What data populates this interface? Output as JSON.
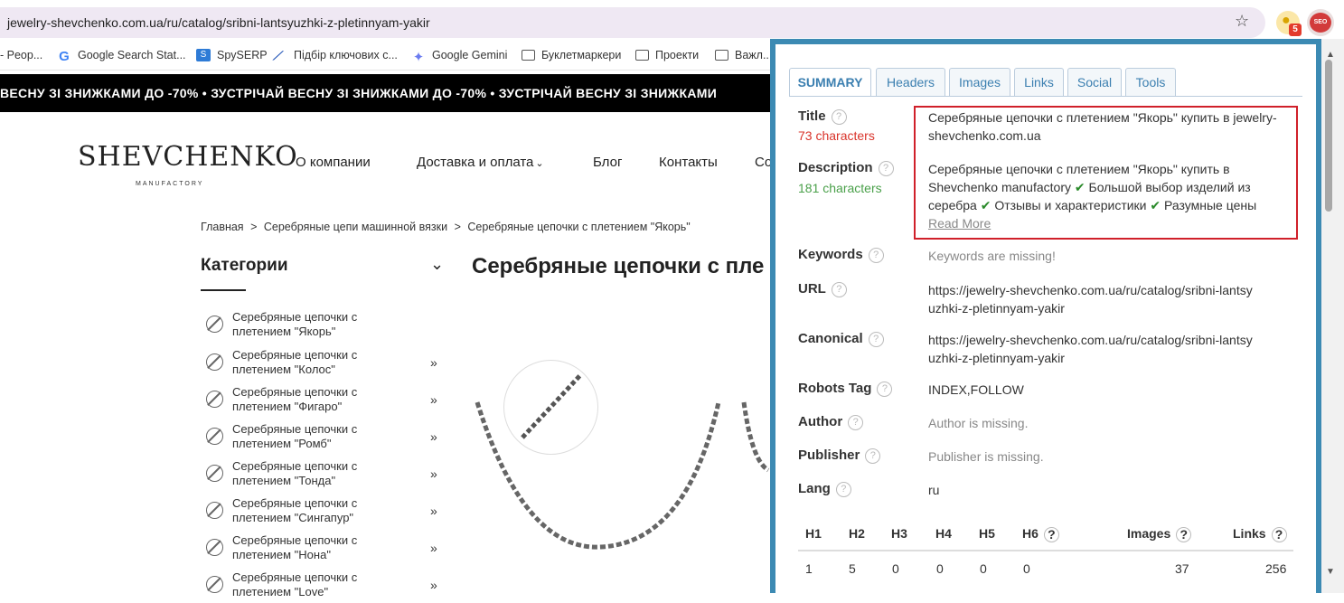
{
  "browser": {
    "url": "jewelry-shevchenko.com.ua/ru/catalog/sribni-lantsyuzhki-z-pletinnyam-yakir",
    "extension_badge": "5",
    "seo_ext_label": "SEO",
    "bookmarks": [
      {
        "label": "- Peop...",
        "icon": "none"
      },
      {
        "label": "Google Search Stat...",
        "icon": "google-icon"
      },
      {
        "label": "SpySERP",
        "icon": "spyserp-icon"
      },
      {
        "label": "Підбір ключових с...",
        "icon": "keyword-icon"
      },
      {
        "label": "Google Gemini",
        "icon": "gemini-icon"
      },
      {
        "label": "Буклетмаркери",
        "icon": "folder-icon"
      },
      {
        "label": "Проекти",
        "icon": "folder-icon"
      },
      {
        "label": "Важл...",
        "icon": "folder-icon"
      }
    ]
  },
  "site": {
    "ticker": "ВЕСНУ ЗІ ЗНИЖКАМИ ДО -70% • ЗУСТРІЧАЙ ВЕСНУ ЗІ ЗНИЖКАМИ ДО -70% • ЗУСТРІЧАЙ ВЕСНУ ЗІ ЗНИЖКАМИ",
    "logo": "SHEVCHENKO",
    "logo_sub": "MANUFACTORY",
    "nav": [
      "О компании",
      "Доставка и оплата",
      "Блог",
      "Контакты",
      "Co"
    ],
    "breadcrumbs": [
      "Главная",
      ">",
      "Серебряные цепи машинной вязки",
      ">",
      "Серебряные цепочки с плетением \"Якорь\""
    ],
    "categories_title": "Категории",
    "page_title": "Серебряные цепочки с пле",
    "categories": [
      {
        "label": "Серебряные цепочки с плетением \"Якорь\"",
        "arrow": ""
      },
      {
        "label": "Серебряные цепочки с плетением \"Колос\"",
        "arrow": "»"
      },
      {
        "label": "Серебряные цепочки с плетением \"Фигаро\"",
        "arrow": "»"
      },
      {
        "label": "Серебряные цепочки с плетением \"Ромб\"",
        "arrow": "»"
      },
      {
        "label": "Серебряные цепочки с плетением \"Тонда\"",
        "arrow": "»"
      },
      {
        "label": "Серебряные цепочки с плетением \"Сингапур\"",
        "arrow": "»"
      },
      {
        "label": "Серебряные цепочки с плетением \"Нона\"",
        "arrow": "»"
      },
      {
        "label": "Серебряные цепочки с плетением \"Love\"",
        "arrow": "»"
      }
    ]
  },
  "seo": {
    "tabs": [
      "SUMMARY",
      "Headers",
      "Images",
      "Links",
      "Social",
      "Tools"
    ],
    "title_label": "Title",
    "title_count": "73 characters",
    "title_value": "Серебряные цепочки с плетением \"Якорь\" купить в jewelry-shevchenko.com.ua",
    "description_label": "Description",
    "description_count": "181 characters",
    "description_part1": "Серебряные цепочки с плетением \"Якорь\" купить в Shevchenko manufactory",
    "description_part2": "Большой выбор изделий из серебра",
    "description_part3": "Отзывы и характеристики",
    "description_part4": "Разумные цены",
    "tick": "✔",
    "read_more": "Read More",
    "keywords_label": "Keywords",
    "keywords_value": "Keywords are missing!",
    "url_label": "URL",
    "url_value": "https://jewelry-shevchenko.com.ua/ru/catalog/sribni-lantsyuzhki-z-pletinnyam-yakir",
    "canonical_label": "Canonical",
    "canonical_value": "https://jewelry-shevchenko.com.ua/ru/catalog/sribni-lantsyuzhki-z-pletinnyam-yakir",
    "robots_label": "Robots Tag",
    "robots_value": "INDEX,FOLLOW",
    "author_label": "Author",
    "author_value": "Author is missing.",
    "publisher_label": "Publisher",
    "publisher_value": "Publisher is missing.",
    "lang_label": "Lang",
    "lang_value": "ru",
    "headers": [
      "H1",
      "H2",
      "H3",
      "H4",
      "H5",
      "H6",
      "Images",
      "Links"
    ],
    "values": [
      "1",
      "5",
      "0",
      "0",
      "0",
      "0",
      "37",
      "256"
    ],
    "help": "?"
  }
}
